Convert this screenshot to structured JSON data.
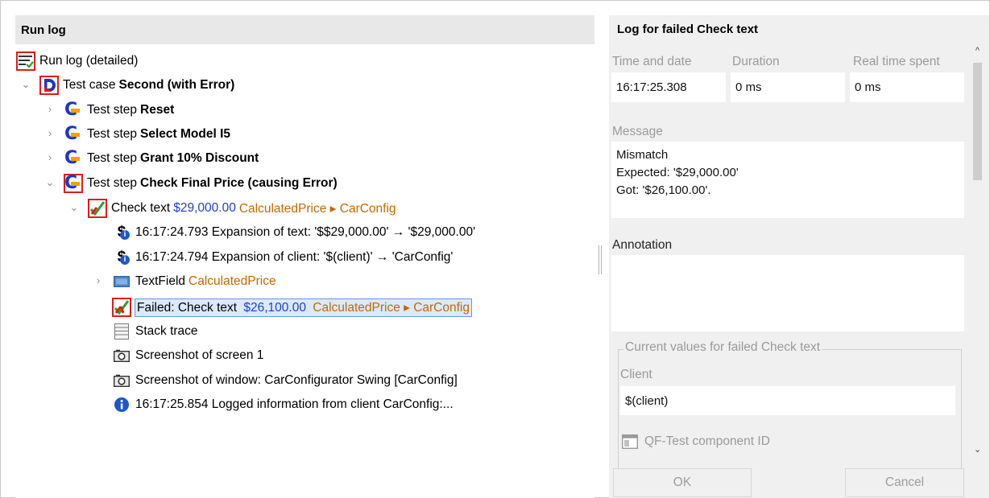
{
  "left": {
    "header": "Run log",
    "root": "Run log (detailed)",
    "testcase": {
      "prefix": "Test case ",
      "name": "Second (with Error)"
    },
    "steps": [
      {
        "prefix": "Test step ",
        "name": "Reset"
      },
      {
        "prefix": "Test step ",
        "name": "Select Model I5"
      },
      {
        "prefix": "Test step ",
        "name": "Grant 10% Discount"
      },
      {
        "prefix": "Test step ",
        "name": "Check Final Price (causing Error)"
      }
    ],
    "check": {
      "label": "Check text",
      "value": "$29,000.00",
      "target": "CalculatedPrice ▸ CarConfig"
    },
    "expansion1": "16:17:24.793 Expansion of text: '$$29,000.00' → '$29,000.00'",
    "expansion2": "16:17:24.794 Expansion of client: '$(client)' → 'CarConfig'",
    "textfield": {
      "label": "TextField",
      "target": "CalculatedPrice"
    },
    "failed": {
      "label": "Failed: Check text",
      "value": "$26,100.00",
      "target": "CalculatedPrice ▸ CarConfig"
    },
    "stacktrace": "Stack trace",
    "screenshot1": "Screenshot of screen 1",
    "screenshot2": "Screenshot of window: CarConfigurator Swing [CarConfig]",
    "loginfo": "16:17:25.854 Logged information from client CarConfig:..."
  },
  "right": {
    "title": "Log for failed Check text",
    "time_label": "Time and date",
    "time_value": "16:17:25.308",
    "duration_label": "Duration",
    "duration_value": "0 ms",
    "realtime_label": "Real time spent",
    "realtime_value": "0 ms",
    "message_label": "Message",
    "message_lines": [
      "Mismatch",
      "Expected: '$29,000.00'",
      "Got: '$26,100.00'."
    ],
    "annotation_label": "Annotation",
    "annotation_value": "",
    "group_title": "Current values for failed Check text",
    "client_label": "Client",
    "client_value": "$(client)",
    "component_label": "QF-Test component ID",
    "ok": "OK",
    "cancel": "Cancel"
  },
  "colors": {
    "accent_blue": "#1f3fd6",
    "accent_orange": "#c26a00",
    "error_red": "#e01b1b",
    "check_green": "#2e9e2e"
  }
}
